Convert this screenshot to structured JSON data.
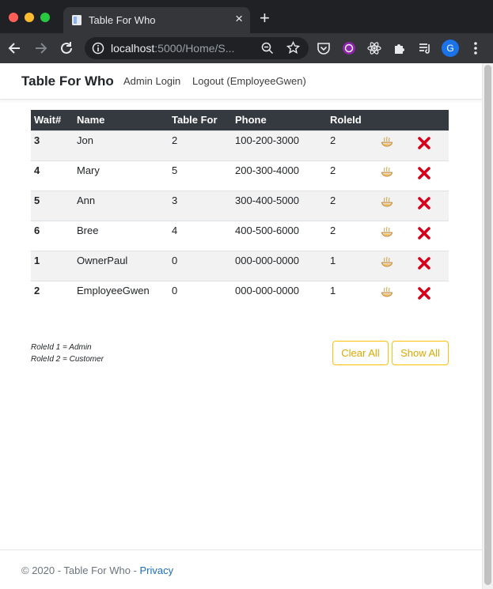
{
  "browser": {
    "tab_title": "Table For Who",
    "url_host": "localhost",
    "url_path": ":5000/Home/S...",
    "profile_initial": "G"
  },
  "navbar": {
    "brand": "Table For Who",
    "links": [
      "Admin Login",
      "Logout (EmployeeGwen)"
    ]
  },
  "table": {
    "headers": [
      "Wait#",
      "Name",
      "Table For",
      "Phone",
      "RoleId"
    ],
    "rows": [
      {
        "wait": "3",
        "name": "Jon",
        "table_for": "2",
        "phone": "100-200-3000",
        "role": "2"
      },
      {
        "wait": "4",
        "name": "Mary",
        "table_for": "5",
        "phone": "200-300-4000",
        "role": "2"
      },
      {
        "wait": "5",
        "name": "Ann",
        "table_for": "3",
        "phone": "300-400-5000",
        "role": "2"
      },
      {
        "wait": "6",
        "name": "Bree",
        "table_for": "4",
        "phone": "400-500-6000",
        "role": "2"
      },
      {
        "wait": "1",
        "name": "OwnerPaul",
        "table_for": "0",
        "phone": "000-000-0000",
        "role": "1"
      },
      {
        "wait": "2",
        "name": "EmployeeGwen",
        "table_for": "0",
        "phone": "000-000-0000",
        "role": "1"
      }
    ]
  },
  "legend": [
    "RoleId 1 = Admin",
    "RoleId 2 = Customer"
  ],
  "buttons": {
    "clear_all": "Clear All",
    "show_all": "Show All"
  },
  "footer": {
    "text": "© 2020 - Table For Who - ",
    "privacy_link": "Privacy"
  },
  "colors": {
    "accent": "#ffc107",
    "header_bg": "#343a40",
    "link": "#1b6ec2",
    "delete": "#d9001b"
  },
  "icons": {
    "seat": "noodle-bowl-icon",
    "delete": "red-x-icon"
  }
}
